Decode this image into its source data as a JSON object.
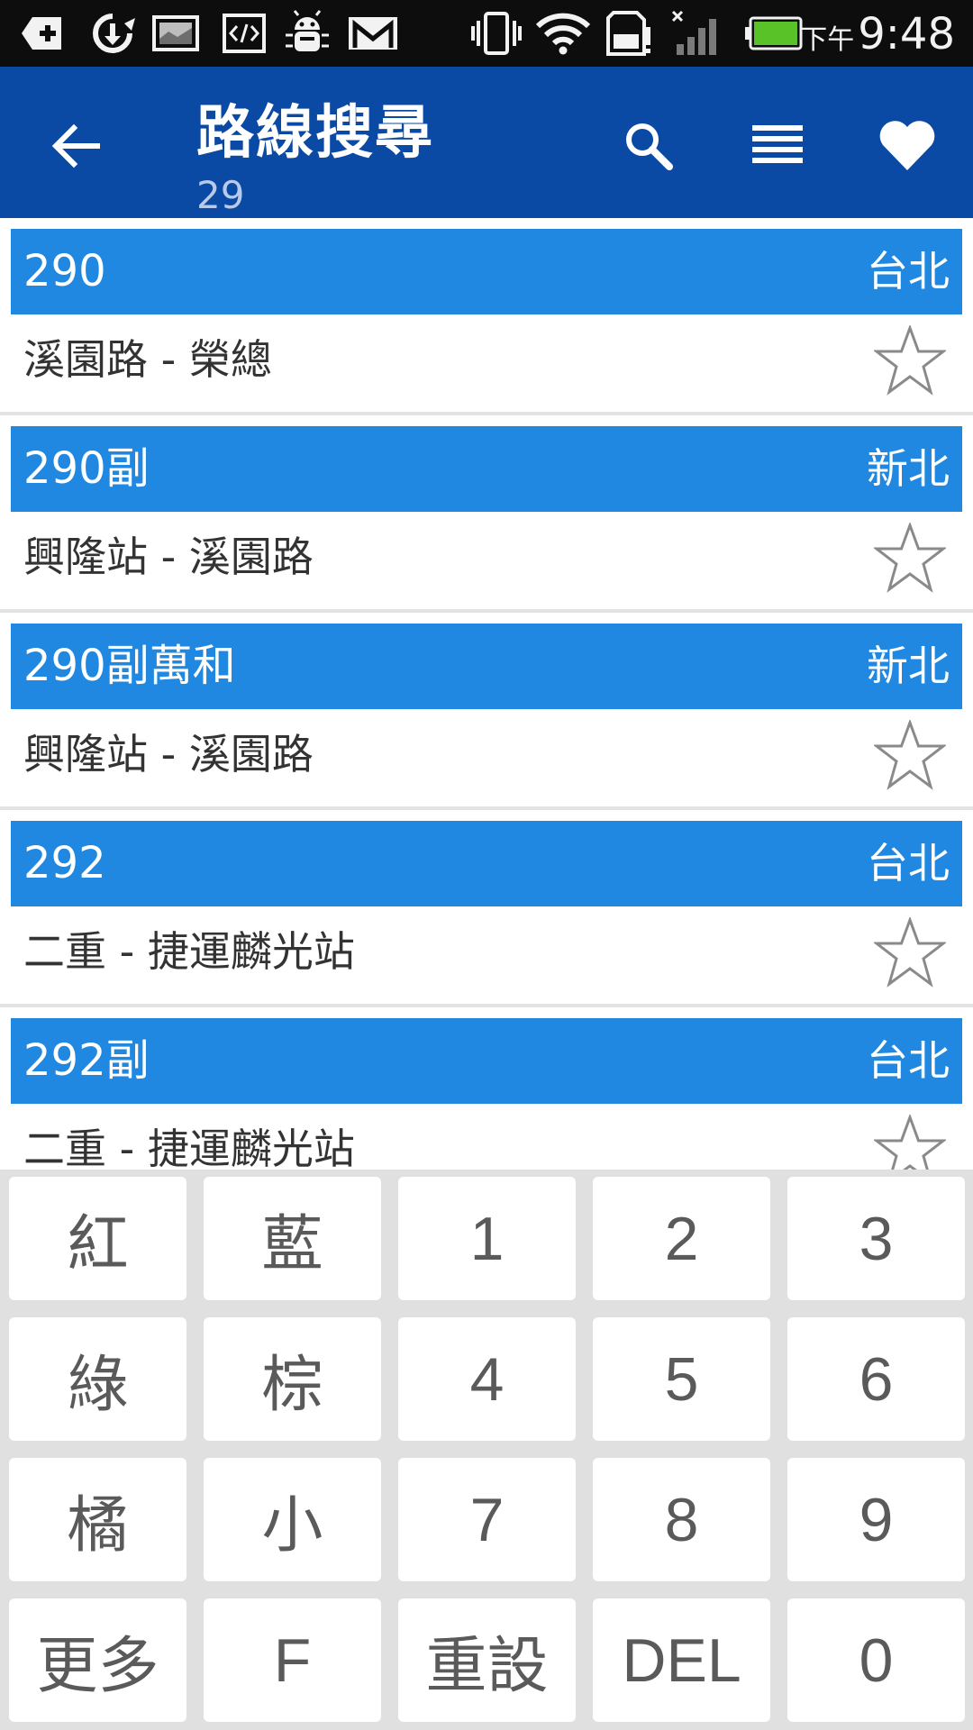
{
  "status_bar": {
    "icons_left": [
      "add-box-icon",
      "sync-download-icon",
      "image-icon",
      "code-icon",
      "bug-droid-icon",
      "gmail-icon"
    ],
    "icons_right": [
      "vibrate-icon",
      "wifi-icon",
      "sd-card-alert-icon",
      "signal-off-icon",
      "battery-icon"
    ],
    "ampm": "下午",
    "time": "9:48"
  },
  "action_bar": {
    "title": "路線搜尋",
    "query": "29",
    "actions": [
      "search-icon",
      "menu-lines-icon",
      "heart-icon"
    ]
  },
  "routes": [
    {
      "number": "290",
      "city": "台北",
      "stops": "溪園路 - 榮總"
    },
    {
      "number": "290副",
      "city": "新北",
      "stops": "興隆站 - 溪園路"
    },
    {
      "number": "290副萬和",
      "city": "新北",
      "stops": "興隆站 - 溪園路"
    },
    {
      "number": "292",
      "city": "台北",
      "stops": "二重 - 捷運麟光站"
    },
    {
      "number": "292副",
      "city": "台北",
      "stops": "二重 - 捷運麟光站"
    }
  ],
  "keypad": {
    "rows": [
      [
        "紅",
        "藍",
        "1",
        "2",
        "3"
      ],
      [
        "綠",
        "棕",
        "4",
        "5",
        "6"
      ],
      [
        "橘",
        "小",
        "7",
        "8",
        "9"
      ],
      [
        "更多",
        "F",
        "重設",
        "DEL",
        "0"
      ]
    ]
  },
  "colors": {
    "action_bar": "#0a4aa5",
    "route_header": "#2088e0",
    "status_bar": "#0d0d0d",
    "keypad_bg": "#e0e0e0"
  }
}
